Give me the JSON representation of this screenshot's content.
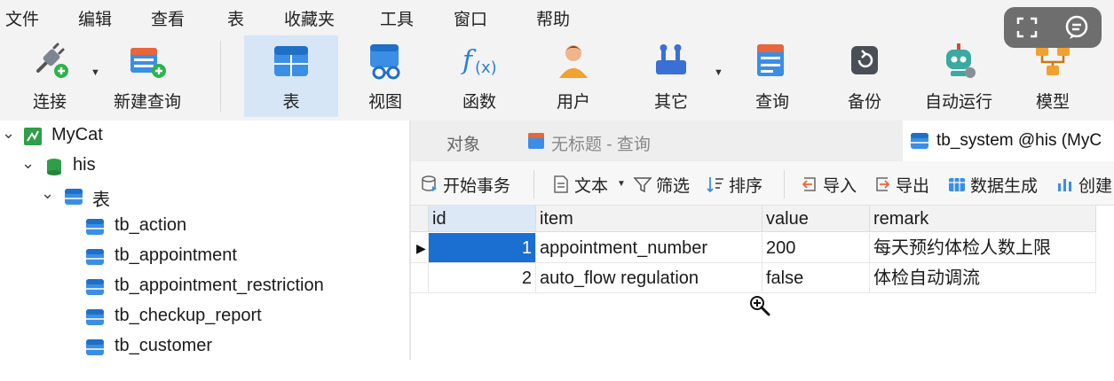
{
  "menu": [
    "文件",
    "编辑",
    "查看",
    "表",
    "收藏夹",
    "工具",
    "窗口",
    "帮助"
  ],
  "toolbar": {
    "connect": "连接",
    "new_query": "新建查询",
    "table": "表",
    "view": "视图",
    "function": "函数",
    "user": "用户",
    "other": "其它",
    "query": "查询",
    "backup": "备份",
    "automation": "自动运行",
    "model": "模型"
  },
  "tree": {
    "connection": "MyCat",
    "database": "his",
    "tables_group": "表",
    "tables": [
      "tb_action",
      "tb_appointment",
      "tb_appointment_restriction",
      "tb_checkup_report",
      "tb_customer"
    ]
  },
  "tabs": {
    "objects": "对象",
    "query": "无标题 - 查询",
    "current": "tb_system @his (MyC"
  },
  "subtoolbar": {
    "begin_transaction": "开始事务",
    "text": "文本",
    "filter": "筛选",
    "sort": "排序",
    "import": "导入",
    "export": "导出",
    "data_generation": "数据生成",
    "create": "创建"
  },
  "grid": {
    "columns": [
      "id",
      "item",
      "value",
      "remark"
    ],
    "rows": [
      {
        "id": "1",
        "item": "appointment_number",
        "value": "200",
        "remark": "每天预约体检人数上限"
      },
      {
        "id": "2",
        "item": "auto_flow regulation",
        "value": "false",
        "remark": "体检自动调流"
      }
    ]
  },
  "colors": {
    "selection": "#1a6fd1",
    "active_tool": "#d6e6f6",
    "table_icon": "#3a8ee6"
  }
}
